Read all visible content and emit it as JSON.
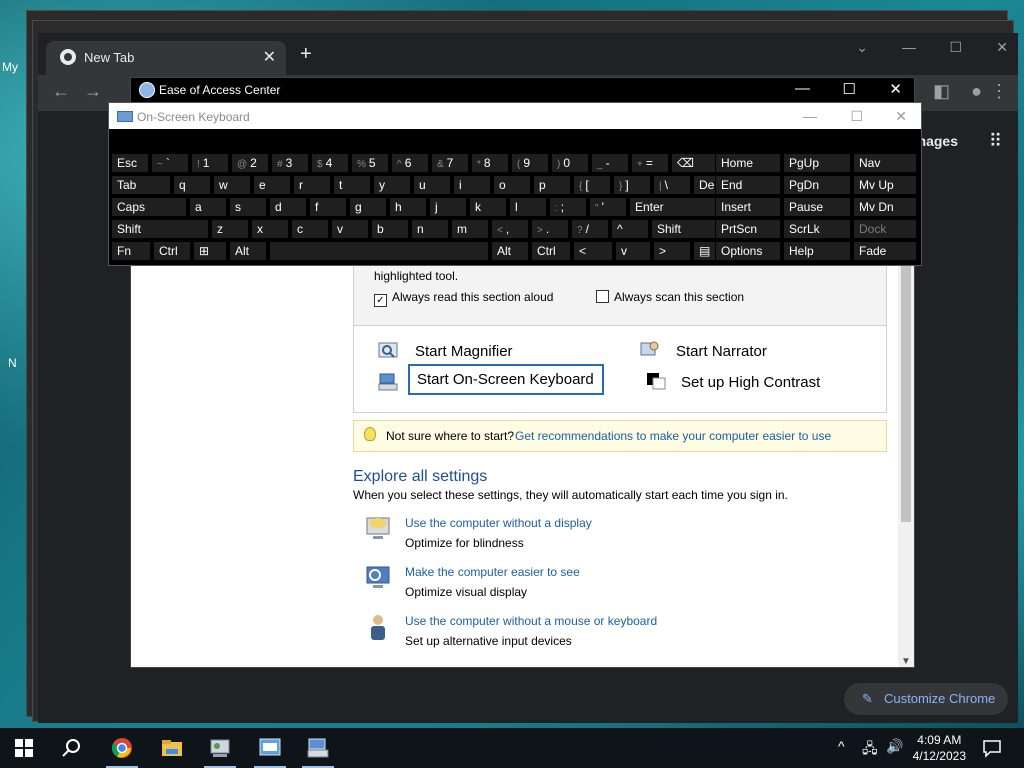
{
  "desktop": {
    "label1": "My",
    "label2": "N"
  },
  "chrome": {
    "tab_title": "New Tab",
    "tab_close": "✕",
    "new_tab": "+",
    "images_link": "Images",
    "apps_icon": "⋮⋮⋮",
    "customize": "Customize Chrome"
  },
  "eac": {
    "title": "Ease of Access Center",
    "highlighted": "highlighted tool.",
    "always_read": "Always read this section aloud",
    "always_scan": "Always scan this section",
    "start_magnifier": "Start Magnifier",
    "start_narrator": "Start Narrator",
    "start_osk": "Start On-Screen Keyboard",
    "high_contrast": "Set up High Contrast",
    "tip_text": "Not sure where to start?",
    "tip_link": "Get recommendations to make your computer easier to use",
    "explore_title": "Explore all settings",
    "explore_sub": "When you select these settings, they will automatically start each time you sign in.",
    "settings": [
      {
        "link": "Use the computer without a display",
        "desc": "Optimize for blindness"
      },
      {
        "link": "Make the computer easier to see",
        "desc": "Optimize visual display"
      },
      {
        "link": "Use the computer without a mouse or keyboard",
        "desc": "Set up alternative input devices"
      }
    ]
  },
  "osk": {
    "title": "On-Screen Keyboard",
    "rows": [
      [
        "Esc",
        "~ `",
        "! 1",
        "@ 2",
        "# 3",
        "$ 4",
        "% 5",
        "^ 6",
        "& 7",
        "* 8",
        "( 9",
        ") 0",
        "_ -",
        "+ =",
        "⌫"
      ],
      [
        "Tab",
        "q",
        "w",
        "e",
        "r",
        "t",
        "y",
        "u",
        "i",
        "o",
        "p",
        "{ [",
        "} ]",
        "| \\",
        "Del"
      ],
      [
        "Caps",
        "a",
        "s",
        "d",
        "f",
        "g",
        "h",
        "j",
        "k",
        "l",
        ": ;",
        "\" '",
        "Enter"
      ],
      [
        "Shift",
        "z",
        "x",
        "c",
        "v",
        "b",
        "n",
        "m",
        "< ,",
        "> .",
        "? /",
        "^",
        "Shift"
      ],
      [
        "Fn",
        "Ctrl",
        "⊞",
        "Alt",
        "",
        "Alt",
        "Ctrl",
        "<",
        "v",
        ">",
        "▤"
      ]
    ],
    "nav_keys": [
      [
        "Home",
        "PgUp",
        "Nav"
      ],
      [
        "End",
        "PgDn",
        "Mv Up"
      ],
      [
        "Insert",
        "Pause",
        "Mv Dn"
      ],
      [
        "PrtScn",
        "ScrLk",
        "Dock"
      ],
      [
        "Options",
        "Help",
        "Fade"
      ]
    ]
  },
  "taskbar": {
    "time": "4:09 AM",
    "date": "4/12/2023"
  }
}
